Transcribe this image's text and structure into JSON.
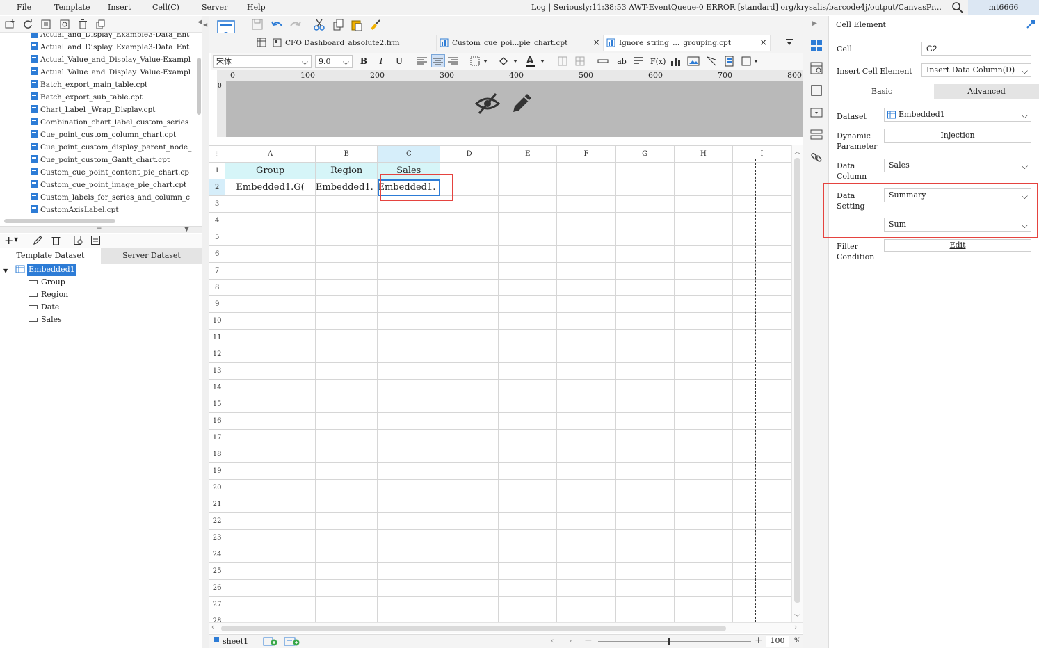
{
  "menubar": {
    "items": [
      "File",
      "Template",
      "Insert",
      "Cell(C)",
      "Server",
      "Help"
    ],
    "log_text": "Log | Seriously:11:38:53 AWT-EventQueue-0 ERROR [standard] org/krysalis/barcode4j/output/CanvasPr...",
    "user": "mt6666"
  },
  "file_list": [
    "Actual_and_Display_Example3-Data_Ent",
    "Actual_Value_and_Display_Value-Exampl",
    "Actual_Value_and_Display_Value-Exampl",
    "Batch_export_main_table.cpt",
    "Batch_export_sub_table.cpt",
    "Chart_Label _Wrap_Display.cpt",
    "Combination_chart_label_custom_series",
    "Cue_point_custom_column_chart.cpt",
    "Cue_point_custom_display_parent_node_",
    "Cue_point_custom_Gantt_chart.cpt",
    "Custom_cue_point_content_pie_chart.cp",
    "Custom_cue_point_image_pie_chart.cpt",
    "Custom_labels_for_series_and_column_c",
    "CustomAxisLabel.cpt"
  ],
  "dataset_tabs": [
    "Template Dataset",
    "Server Dataset"
  ],
  "dataset_tree": {
    "name": "Embedded1",
    "fields": [
      "Group",
      "Region",
      "Date",
      "Sales"
    ]
  },
  "editor_tabs": [
    {
      "label": "CFO Dashboard_absolute2.frm",
      "close": ""
    },
    {
      "label": "Custom_cue_poi...pie_chart.cpt",
      "close": "×"
    },
    {
      "label": "Ignore_string_..._grouping.cpt",
      "close": "×"
    }
  ],
  "format_bar": {
    "font": "宋体",
    "size": "9.0",
    "bold": "B",
    "italic": "I",
    "underline": "U",
    "formula": "F(x)",
    "ab": "ab"
  },
  "ruler_marks": [
    "0",
    "100",
    "200",
    "300",
    "400",
    "500",
    "600",
    "700",
    "800"
  ],
  "grid": {
    "columns": [
      "A",
      "B",
      "C",
      "D",
      "E",
      "F",
      "G",
      "H",
      "I"
    ],
    "selected_column": "C",
    "rows": [
      "1",
      "2",
      "3",
      "4",
      "5",
      "6",
      "7",
      "8",
      "9",
      "10",
      "11",
      "12",
      "13",
      "14",
      "15",
      "16",
      "17",
      "18",
      "19",
      "20",
      "21",
      "22",
      "23",
      "24",
      "25",
      "26",
      "27",
      "28"
    ],
    "row1": [
      "Group",
      "Region",
      "Sales"
    ],
    "row2": [
      "Embedded1.G(",
      "Embedded1.",
      "Embedded1."
    ]
  },
  "status_bar": {
    "sheet": "sheet1",
    "zoom": "100",
    "percent": "%",
    "minus": "−",
    "plus": "+"
  },
  "right_panel": {
    "title": "Cell Element",
    "cell_label": "Cell",
    "cell_value": "C2",
    "insert_label": "Insert Cell Element",
    "insert_value": "Insert Data Column(D)",
    "tabs": [
      "Basic",
      "Advanced"
    ],
    "dataset_label": "Dataset",
    "dataset_value": "Embedded1",
    "dynamic_label_1": "Dynamic",
    "dynamic_label_2": "Parameter",
    "dynamic_button": "Injection",
    "column_label_1": "Data",
    "column_label_2": "Column",
    "column_value": "Sales",
    "setting_label_1": "Data",
    "setting_label_2": "Setting",
    "setting_value": "Summary",
    "summary_value": "Sum",
    "filter_label_1": "Filter",
    "filter_label_2": "Condition",
    "filter_button": "Edit"
  },
  "colors": {
    "highlight_red": "#e5433f",
    "selection_blue": "#2d7cd6",
    "header_cyan": "#d6f5f8"
  }
}
